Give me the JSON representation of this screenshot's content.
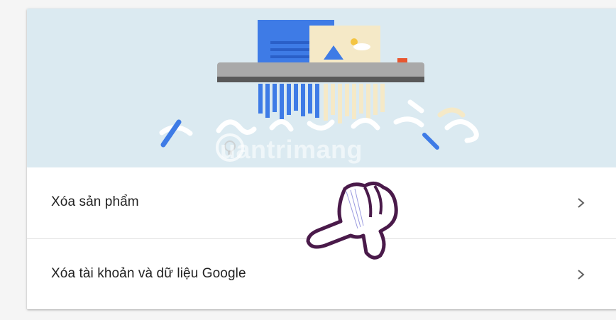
{
  "hero": {
    "illustration": "paper-shredder-illustration"
  },
  "watermark": {
    "text": "uantrimang"
  },
  "rows": [
    {
      "label": "Xóa sản phẩm",
      "icon": "chevron-right-icon"
    },
    {
      "label": "Xóa tài khoản và dữ liệu Google",
      "icon": "chevron-right-icon"
    }
  ],
  "colors": {
    "hero_bg": "#dbeaf1",
    "shredder_body": "#a9a9a9",
    "blue_doc": "#3e7be6",
    "cream_doc": "#f5e9c7",
    "hand_outline": "#4a1a4a"
  }
}
